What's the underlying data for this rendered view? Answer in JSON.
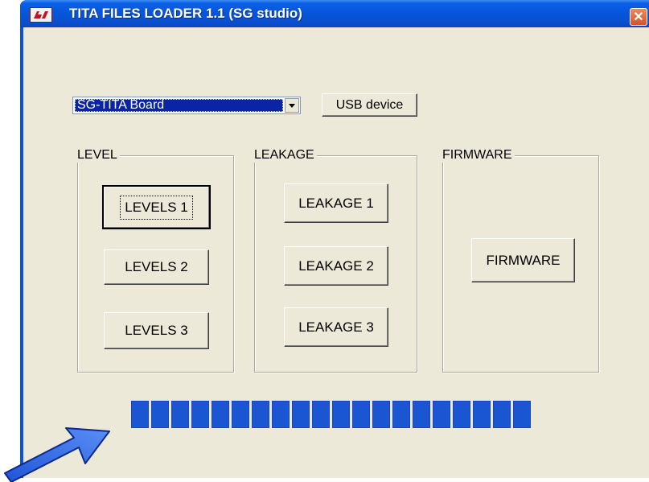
{
  "window": {
    "title": "TITA FILES LOADER 1.1 (SG studio)",
    "close_glyph": "✕"
  },
  "device": {
    "selected": "SG-TITA Board",
    "usb_button": "USB device"
  },
  "groups": {
    "level": {
      "label": "LEVEL",
      "buttons": [
        "LEVELS 1",
        "LEVELS 2",
        "LEVELS 3"
      ]
    },
    "leakage": {
      "label": "LEAKAGE",
      "buttons": [
        "LEAKAGE 1",
        "LEAKAGE 2",
        "LEAKAGE 3"
      ]
    },
    "firmware": {
      "label": "FIRMWARE",
      "button": "FIRMWARE"
    }
  },
  "progress": {
    "fraction": 1.0,
    "blocks": 20
  },
  "colors": {
    "titlebar": "#0654d8",
    "dialog_bg": "#ece9d8",
    "progress_block": "#1a55d2",
    "selection": "#0a24a6",
    "arrow_fill": "#2a64e8"
  },
  "icons": {
    "app": "app-logo-icon",
    "close": "close-icon",
    "dropdown": "chevron-down-icon",
    "annotation": "pointer-arrow-icon"
  }
}
